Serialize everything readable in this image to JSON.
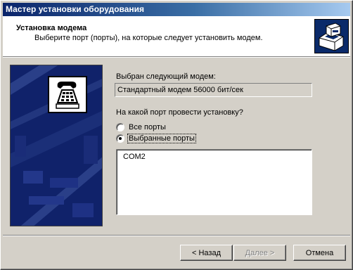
{
  "window": {
    "title": "Мастер установки оборудования"
  },
  "header": {
    "title": "Установка модема",
    "subtitle": "Выберите порт (порты), на которые следует установить модем.",
    "icon": "hardware-wizard-icon"
  },
  "side": {
    "icon": "modem-telephone-icon"
  },
  "form": {
    "selected_modem_label": "Выбран следующий модем:",
    "modem_name": "Стандартный модем 56000 бит/сек",
    "port_question": "На какой порт провести установку?",
    "radio_all_label": "Все порты",
    "radio_selected_label": "Выбранные порты",
    "selected_option": "Выбранные порты",
    "ports": [
      "COM2"
    ]
  },
  "buttons": {
    "back": "< Назад",
    "next": "Далее >",
    "cancel": "Отмена"
  },
  "colors": {
    "titlebar_start": "#0a246a",
    "titlebar_end": "#a6caf0",
    "dialog_face": "#d4d0c8",
    "art_background": "#10226a"
  }
}
